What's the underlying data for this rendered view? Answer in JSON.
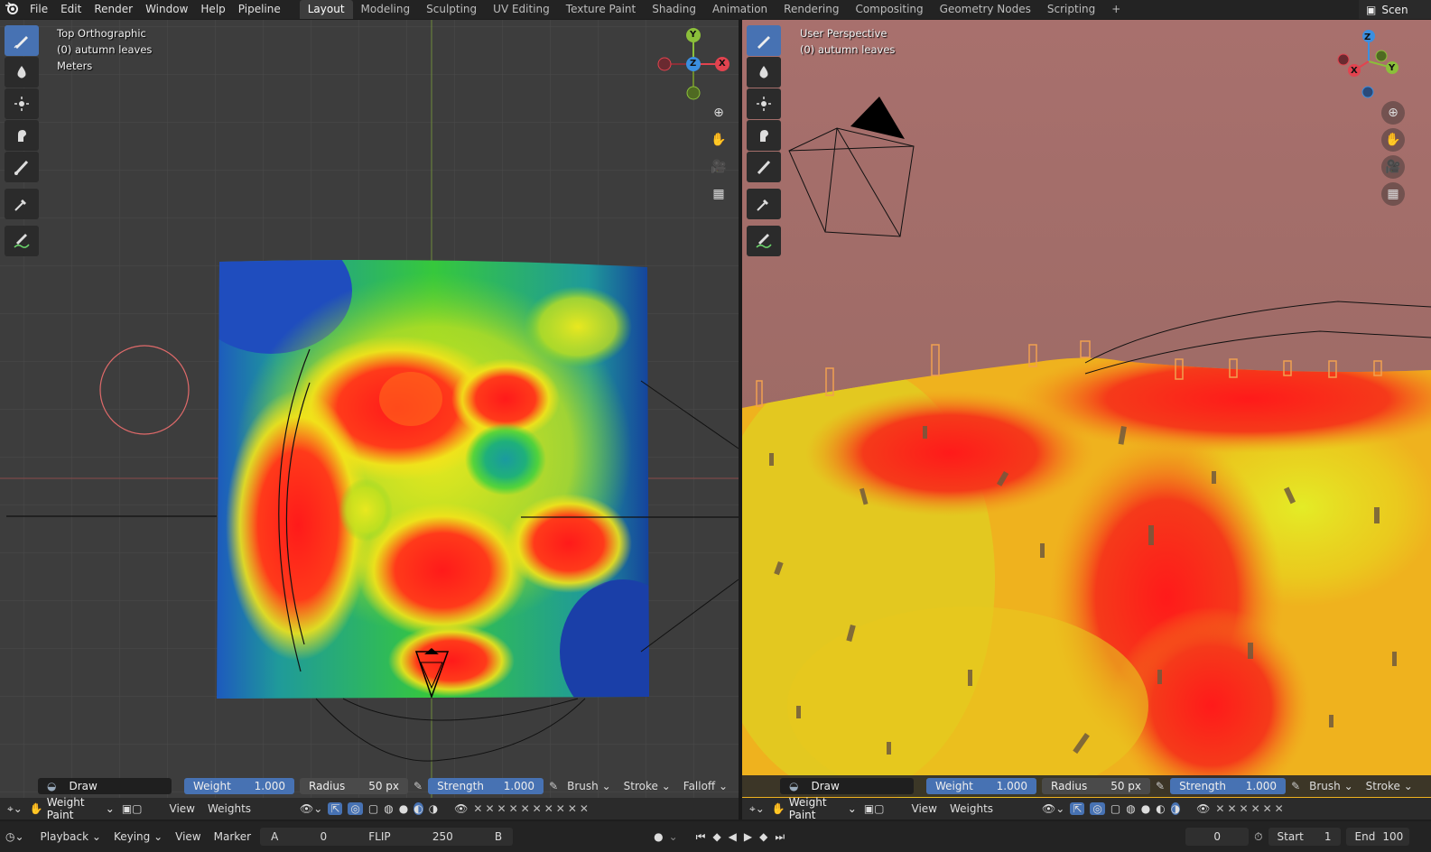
{
  "app": {
    "logo_icon": "blender-logo-icon"
  },
  "menu": [
    "File",
    "Edit",
    "Render",
    "Window",
    "Help",
    "Pipeline"
  ],
  "workspaces": [
    "Layout",
    "Modeling",
    "Sculpting",
    "UV Editing",
    "Texture Paint",
    "Shading",
    "Animation",
    "Rendering",
    "Compositing",
    "Geometry Nodes",
    "Scripting"
  ],
  "active_workspace": "Layout",
  "add_tab": "+",
  "scene_label": "Scen",
  "left_viewport": {
    "view_name": "Top Orthographic",
    "object": "(0) autumn leaves",
    "units": "Meters",
    "gizmo": {
      "x": "X",
      "y": "Y",
      "z": "Z"
    }
  },
  "right_viewport": {
    "view_name": "User Perspective",
    "object": "(0) autumn leaves",
    "gizmo": {
      "x": "X",
      "y": "Y",
      "z": "Z"
    }
  },
  "tool_settings": {
    "brush_name": "Draw",
    "weight_label": "Weight",
    "weight_value": "1.000",
    "radius_label": "Radius",
    "radius_value": "50 px",
    "strength_label": "Strength",
    "strength_value": "1.000",
    "brush_menu": "Brush",
    "stroke_menu": "Stroke",
    "falloff_menu": "Falloff"
  },
  "header": {
    "mode": "Weight Paint",
    "view_menu": "View",
    "weights_menu": "Weights"
  },
  "timeline": {
    "playback": "Playback",
    "keying": "Keying",
    "view": "View",
    "marker": "Marker",
    "a_label": "A",
    "a_value": "0",
    "flip": "FLIP",
    "flip_value": "250",
    "b_label": "B",
    "current_frame": "0",
    "start_label": "Start",
    "start_value": "1",
    "end_label": "End",
    "end_value": "100"
  },
  "colors": {
    "accent": "#4772b3",
    "x_axis": "#e2434f",
    "y_axis": "#8bbf3a",
    "z_axis": "#3b8fe0"
  }
}
